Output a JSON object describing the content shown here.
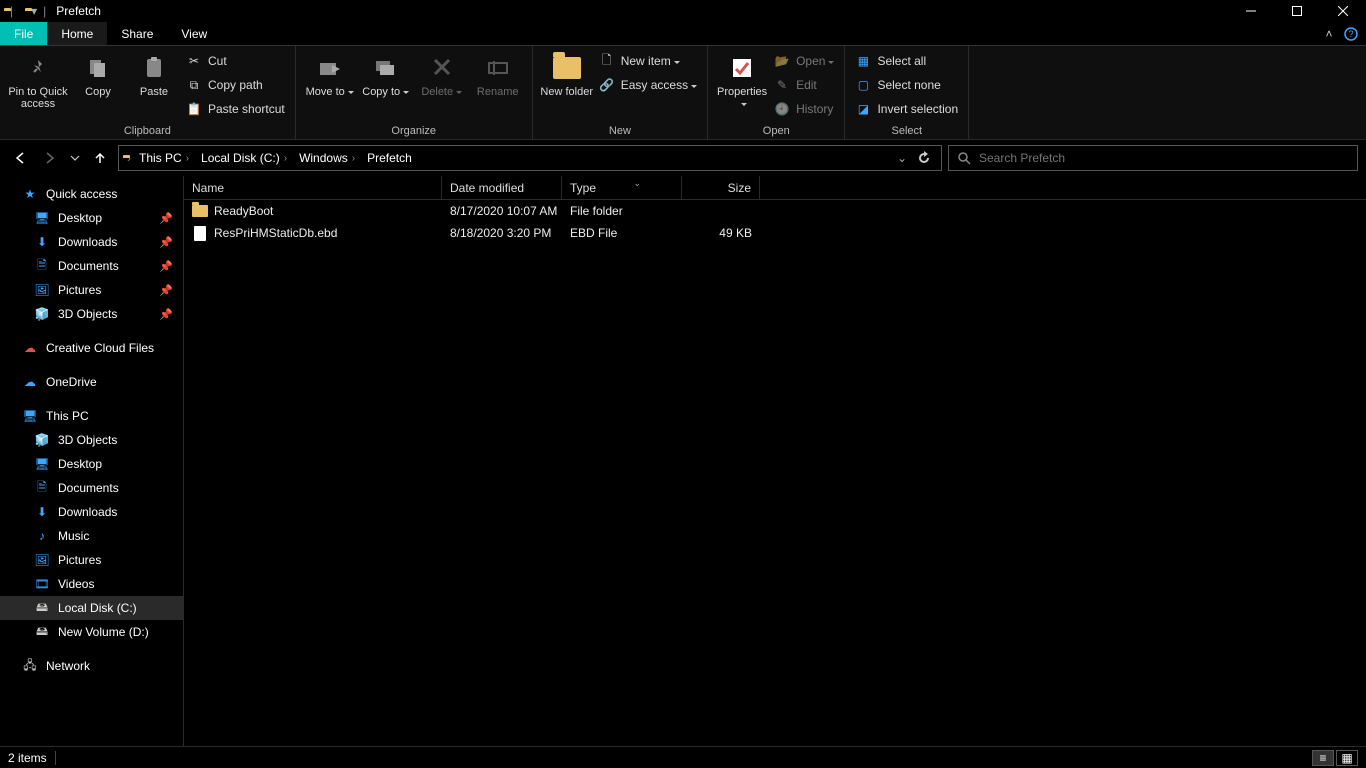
{
  "window": {
    "title": "Prefetch"
  },
  "tabs": {
    "file": "File",
    "home": "Home",
    "share": "Share",
    "view": "View"
  },
  "ribbon": {
    "clipboard": {
      "label": "Clipboard",
      "pin": "Pin to Quick access",
      "copy": "Copy",
      "paste": "Paste",
      "cut": "Cut",
      "copypath": "Copy path",
      "pasteshortcut": "Paste shortcut"
    },
    "organize": {
      "label": "Organize",
      "moveto": "Move to",
      "copyto": "Copy to",
      "delete": "Delete",
      "rename": "Rename"
    },
    "new": {
      "label": "New",
      "newfolder": "New folder",
      "newitem": "New item",
      "easyaccess": "Easy access"
    },
    "open": {
      "label": "Open",
      "properties": "Properties",
      "open": "Open",
      "edit": "Edit",
      "history": "History"
    },
    "select": {
      "label": "Select",
      "all": "Select all",
      "none": "Select none",
      "invert": "Invert selection"
    }
  },
  "breadcrumb": [
    "This PC",
    "Local Disk (C:)",
    "Windows",
    "Prefetch"
  ],
  "search": {
    "placeholder": "Search Prefetch"
  },
  "nav": {
    "quick": "Quick access",
    "quick_items": [
      "Desktop",
      "Downloads",
      "Documents",
      "Pictures",
      "3D Objects"
    ],
    "ccf": "Creative Cloud Files",
    "onedrive": "OneDrive",
    "thispc": "This PC",
    "pc_items": [
      "3D Objects",
      "Desktop",
      "Documents",
      "Downloads",
      "Music",
      "Pictures",
      "Videos",
      "Local Disk (C:)",
      "New Volume (D:)"
    ],
    "network": "Network"
  },
  "columns": {
    "name": "Name",
    "date": "Date modified",
    "type": "Type",
    "size": "Size"
  },
  "files": [
    {
      "name": "ReadyBoot",
      "date": "8/17/2020 10:07 AM",
      "type": "File folder",
      "size": "",
      "kind": "folder"
    },
    {
      "name": "ResPriHMStaticDb.ebd",
      "date": "8/18/2020 3:20 PM",
      "type": "EBD File",
      "size": "49 KB",
      "kind": "file"
    }
  ],
  "status": {
    "count": "2 items"
  }
}
